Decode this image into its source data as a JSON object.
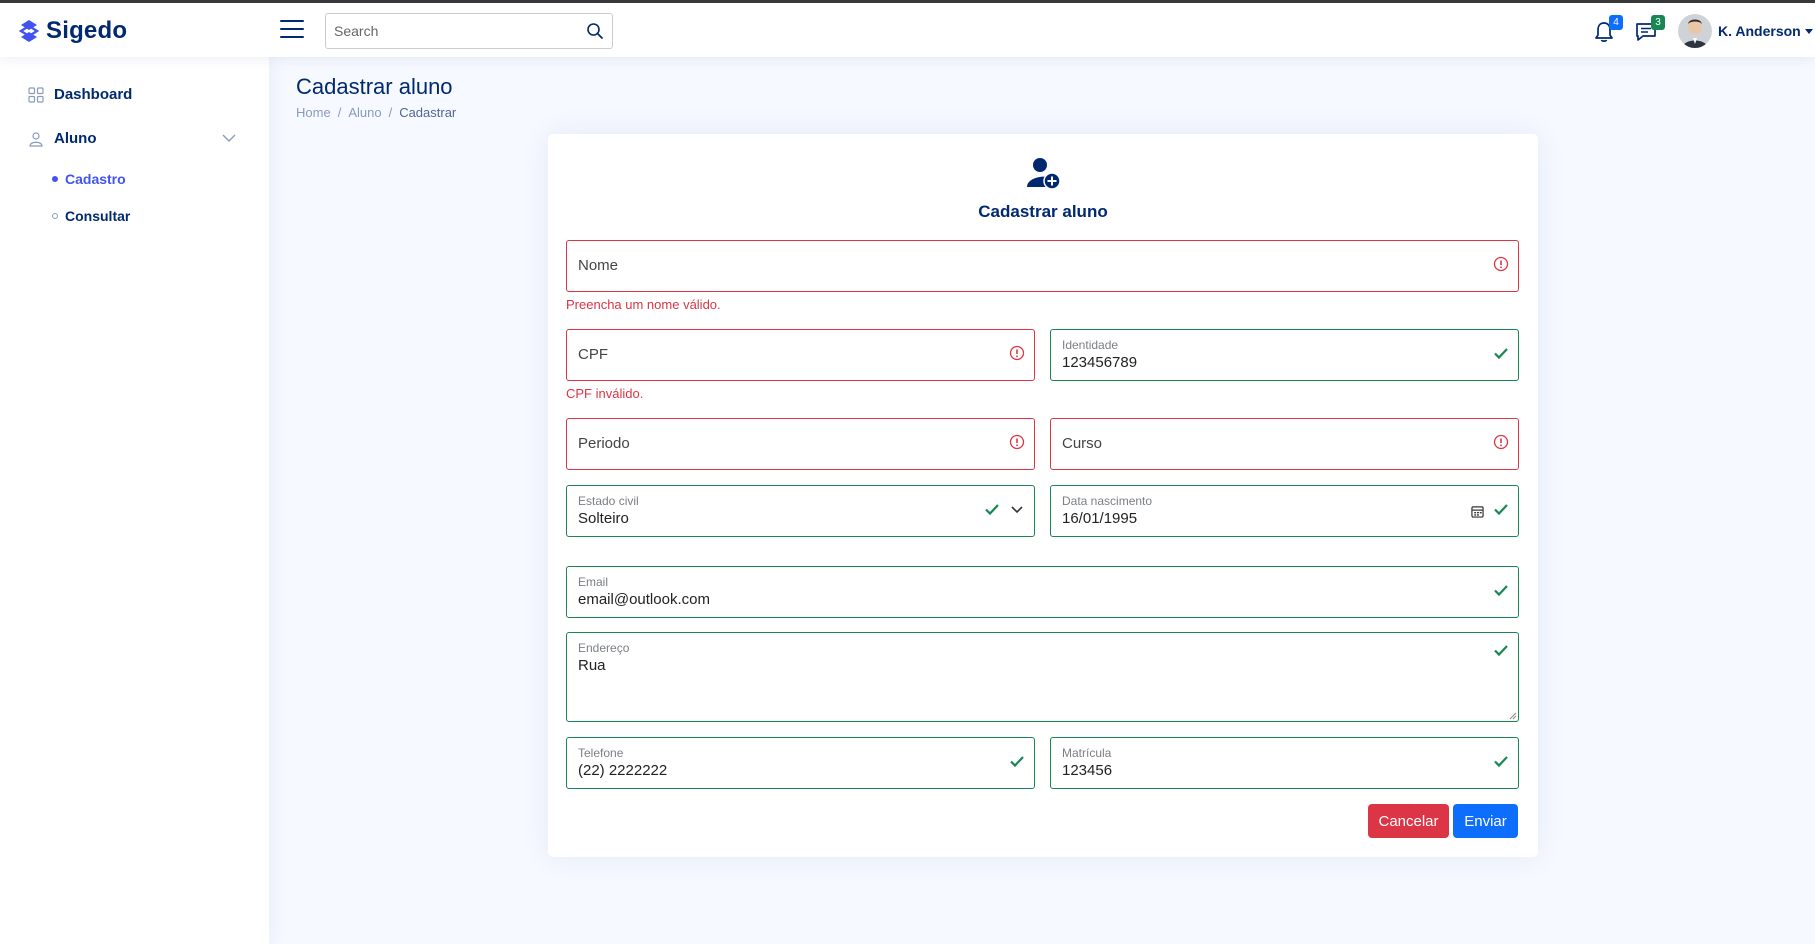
{
  "app": {
    "name": "Sigedo"
  },
  "header": {
    "search_placeholder": "Search",
    "notifications_count": "4",
    "messages_count": "3",
    "user_name": "K. Anderson"
  },
  "sidebar": {
    "dashboard": "Dashboard",
    "aluno": "Aluno",
    "sub_items": [
      "Cadastro",
      "Consultar"
    ],
    "active_sub_item": "Cadastro"
  },
  "page": {
    "title": "Cadastrar aluno",
    "breadcrumb": [
      "Home",
      "Aluno",
      "Cadastrar"
    ]
  },
  "form": {
    "title": "Cadastrar aluno",
    "nome": {
      "placeholder": "Nome",
      "error": "Preencha um nome válido.",
      "state": "invalid"
    },
    "cpf": {
      "placeholder": "CPF",
      "error": "CPF inválido.",
      "state": "invalid"
    },
    "identidade": {
      "label": "Identidade",
      "value": "123456789",
      "state": "valid"
    },
    "periodo": {
      "placeholder": "Periodo",
      "state": "invalid"
    },
    "curso": {
      "placeholder": "Curso",
      "state": "invalid"
    },
    "estado_civil": {
      "label": "Estado civil",
      "value": "Solteiro",
      "state": "valid"
    },
    "data_nascimento": {
      "label": "Data nascimento",
      "value": "16/01/1995",
      "state": "valid"
    },
    "email": {
      "label": "Email",
      "value": "email@outlook.com",
      "state": "valid"
    },
    "endereco": {
      "label": "Endereço",
      "value": "Rua",
      "state": "valid"
    },
    "telefone": {
      "label": "Telefone",
      "value": "(22) 2222222",
      "state": "valid"
    },
    "matricula": {
      "label": "Matrícula",
      "value": "123456",
      "state": "valid"
    },
    "cancel_label": "Cancelar",
    "submit_label": "Enviar"
  },
  "colors": {
    "brand": "#012970",
    "accent": "#4154f1",
    "valid": "#198754",
    "invalid": "#dc3545",
    "primary": "#0d6efd"
  }
}
